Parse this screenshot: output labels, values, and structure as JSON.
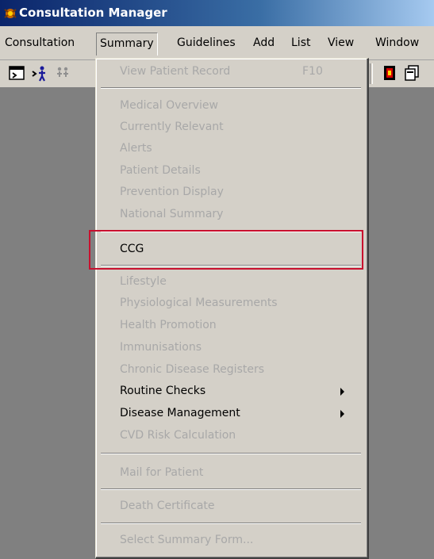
{
  "window": {
    "title": "Consultation Manager"
  },
  "menubar": {
    "items": [
      {
        "label": "Consultation"
      },
      {
        "label": "Summary"
      },
      {
        "label": "Guidelines"
      },
      {
        "label": "Add"
      },
      {
        "label": "List"
      },
      {
        "label": "View"
      },
      {
        "label": "Window"
      }
    ]
  },
  "dropdown": {
    "items": [
      {
        "label": "View Patient Record",
        "shortcut": "F10",
        "enabled": false
      },
      {
        "label": "Medical Overview",
        "enabled": false
      },
      {
        "label": "Currently Relevant",
        "enabled": false
      },
      {
        "label": "Alerts",
        "enabled": false
      },
      {
        "label": "Patient Details",
        "enabled": false
      },
      {
        "label": "Prevention Display",
        "enabled": false
      },
      {
        "label": "National Summary",
        "enabled": false
      },
      {
        "label": "CCG",
        "enabled": true
      },
      {
        "label": "Lifestyle",
        "enabled": false
      },
      {
        "label": "Physiological Measurements",
        "enabled": false
      },
      {
        "label": "Health Promotion",
        "enabled": false
      },
      {
        "label": "Immunisations",
        "enabled": false
      },
      {
        "label": "Chronic Disease Registers",
        "enabled": false
      },
      {
        "label": "Routine Checks",
        "enabled": true,
        "submenu": true
      },
      {
        "label": "Disease Management",
        "enabled": true,
        "submenu": true
      },
      {
        "label": "CVD Risk Calculation",
        "enabled": false
      },
      {
        "label": "Mail for Patient",
        "enabled": false
      },
      {
        "label": "Death Certificate",
        "enabled": false
      },
      {
        "label": "Select Summary Form...",
        "enabled": false
      }
    ]
  },
  "colors": {
    "highlight_border": "#c8102e",
    "titlebar": "#0a246a",
    "disabled_text": "#a8a8a8"
  }
}
